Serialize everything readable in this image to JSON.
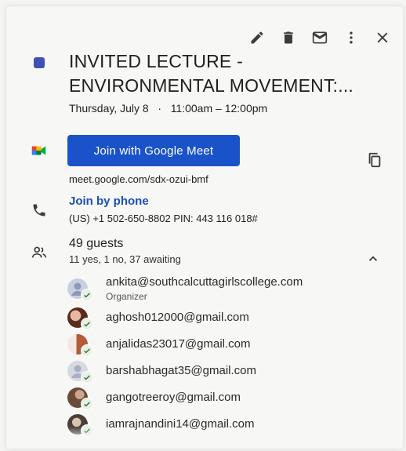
{
  "toolbar": {
    "edit_icon": "pencil-icon",
    "delete_icon": "trash-icon",
    "email_icon": "envelope-icon",
    "more_icon": "more-vertical-icon",
    "close_icon": "close-icon"
  },
  "event": {
    "color": "#3f51b5",
    "title": "INVITED LECTURE - ENVIRONMENTAL MOVEMENT:...",
    "date": "Thursday, July 8",
    "separator": "·",
    "time": "11:00am – 12:00pm"
  },
  "meet": {
    "button_label": "Join with Google Meet",
    "link": "meet.google.com/sdx-ozui-bmf",
    "brand_color": "#1a53c9"
  },
  "phone": {
    "title": "Join by phone",
    "details": "(US) +1 502-650-8802 PIN: 443 116 018#"
  },
  "guests": {
    "title": "49 guests",
    "summary": "11 yes, 1 no, 37 awaiting",
    "list": [
      {
        "email": "ankita@southcalcuttagirlscollege.com",
        "role": "Organizer"
      },
      {
        "email": "aghosh012000@gmail.com",
        "role": ""
      },
      {
        "email": "anjalidas23017@gmail.com",
        "role": ""
      },
      {
        "email": "barshabhagat35@gmail.com",
        "role": ""
      },
      {
        "email": "gangotreeroy@gmail.com",
        "role": ""
      },
      {
        "email": "iamrajnandini14@gmail.com",
        "role": ""
      }
    ]
  }
}
